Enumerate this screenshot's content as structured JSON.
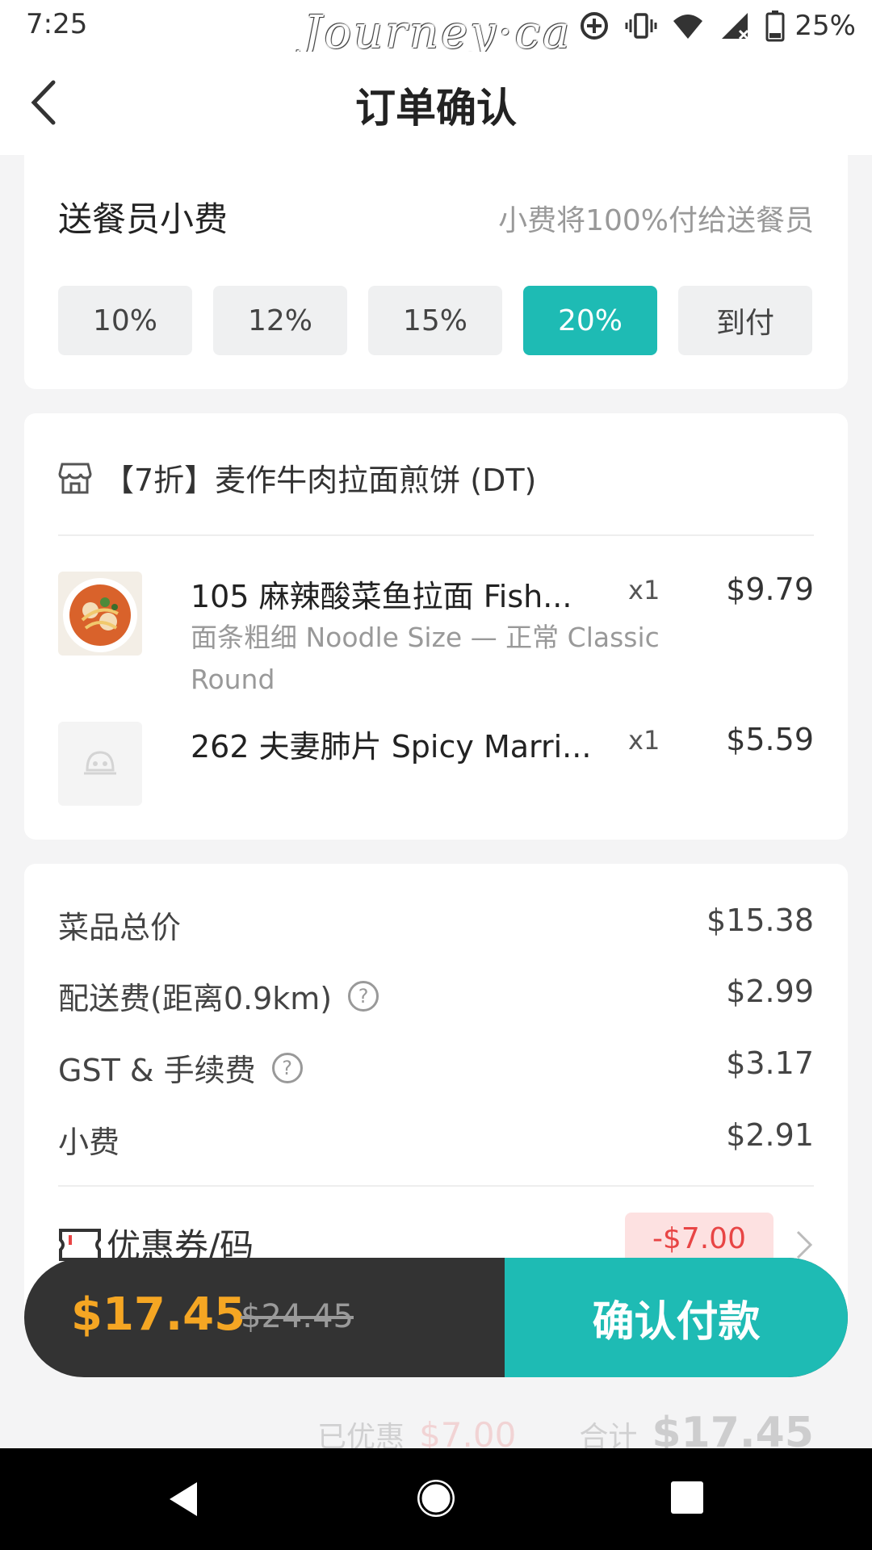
{
  "status_bar": {
    "time": "7:25",
    "brand": "Journey·ca",
    "battery": "25%",
    "icons": [
      "add-circle-icon",
      "vibrate-icon",
      "wifi-icon",
      "signal-icon",
      "battery-icon"
    ]
  },
  "header": {
    "title": "订单确认",
    "back_icon": "chevron-left-icon"
  },
  "tip": {
    "title": "送餐员小费",
    "note": "小费将100%付给送餐员",
    "options": [
      "10%",
      "12%",
      "15%",
      "20%",
      "到付"
    ],
    "selected": "20%",
    "accent_color": "#1ebbb4"
  },
  "store": {
    "icon": "store-icon",
    "name": "【7折】麦作牛肉拉面煎饼 (DT)"
  },
  "items": [
    {
      "name": "105 麻辣酸菜鱼拉面 Fish...",
      "qty": "x1",
      "price": "$9.79",
      "option": "面条粗细 Noodle Size — 正常 Classic Round"
    },
    {
      "name": "262 夫妻肺片 Spicy Marri...",
      "qty": "x1",
      "price": "$5.59"
    }
  ],
  "summary": {
    "subtotal_label": "菜品总价",
    "subtotal": "$15.38",
    "delivery_label": "配送费(距离0.9km)",
    "delivery": "$2.99",
    "gst_label": "GST & 手续费",
    "gst": "$3.17",
    "tip_label": "小费",
    "tip": "$2.91",
    "coupon_label": "优惠券/码",
    "coupon_value": "-$7.00",
    "discount_label": "已优惠",
    "discount": "$7.00",
    "total_label": "合计",
    "total": "$17.45"
  },
  "paybar": {
    "total": "$17.45",
    "original": "$24.45",
    "confirm_label": "确认付款"
  },
  "nav": [
    "back-triangle-icon",
    "home-circle-icon",
    "recents-square-icon"
  ]
}
